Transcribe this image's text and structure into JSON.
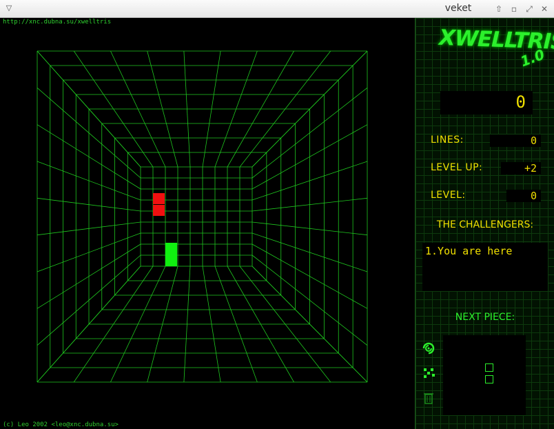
{
  "window": {
    "title": "veket"
  },
  "game": {
    "url": "http://xnc.dubna.su/xwelltris",
    "copyright": "(c) Leo 2002 <leo@xnc.dubna.su>"
  },
  "sidebar": {
    "logo": "XWELLTRIS",
    "version": "1.0",
    "score": "0",
    "lines_label": "LINES:",
    "lines_value": "0",
    "levelup_label": "LEVEL UP:",
    "levelup_value": "+2",
    "level_label": "LEVEL:",
    "level_value": "0",
    "challengers_label": "THE CHALLENGERS:",
    "challengers": [
      "1.You are here"
    ],
    "next_label": "NEXT PIECE:"
  },
  "colors": {
    "grid": "#1fc81f",
    "falling_piece": "#f01010",
    "landed_piece": "#10f010",
    "text_yellow": "#f0e000"
  },
  "icons": [
    "swirl-icon",
    "dots-icon",
    "trash-icon"
  ]
}
